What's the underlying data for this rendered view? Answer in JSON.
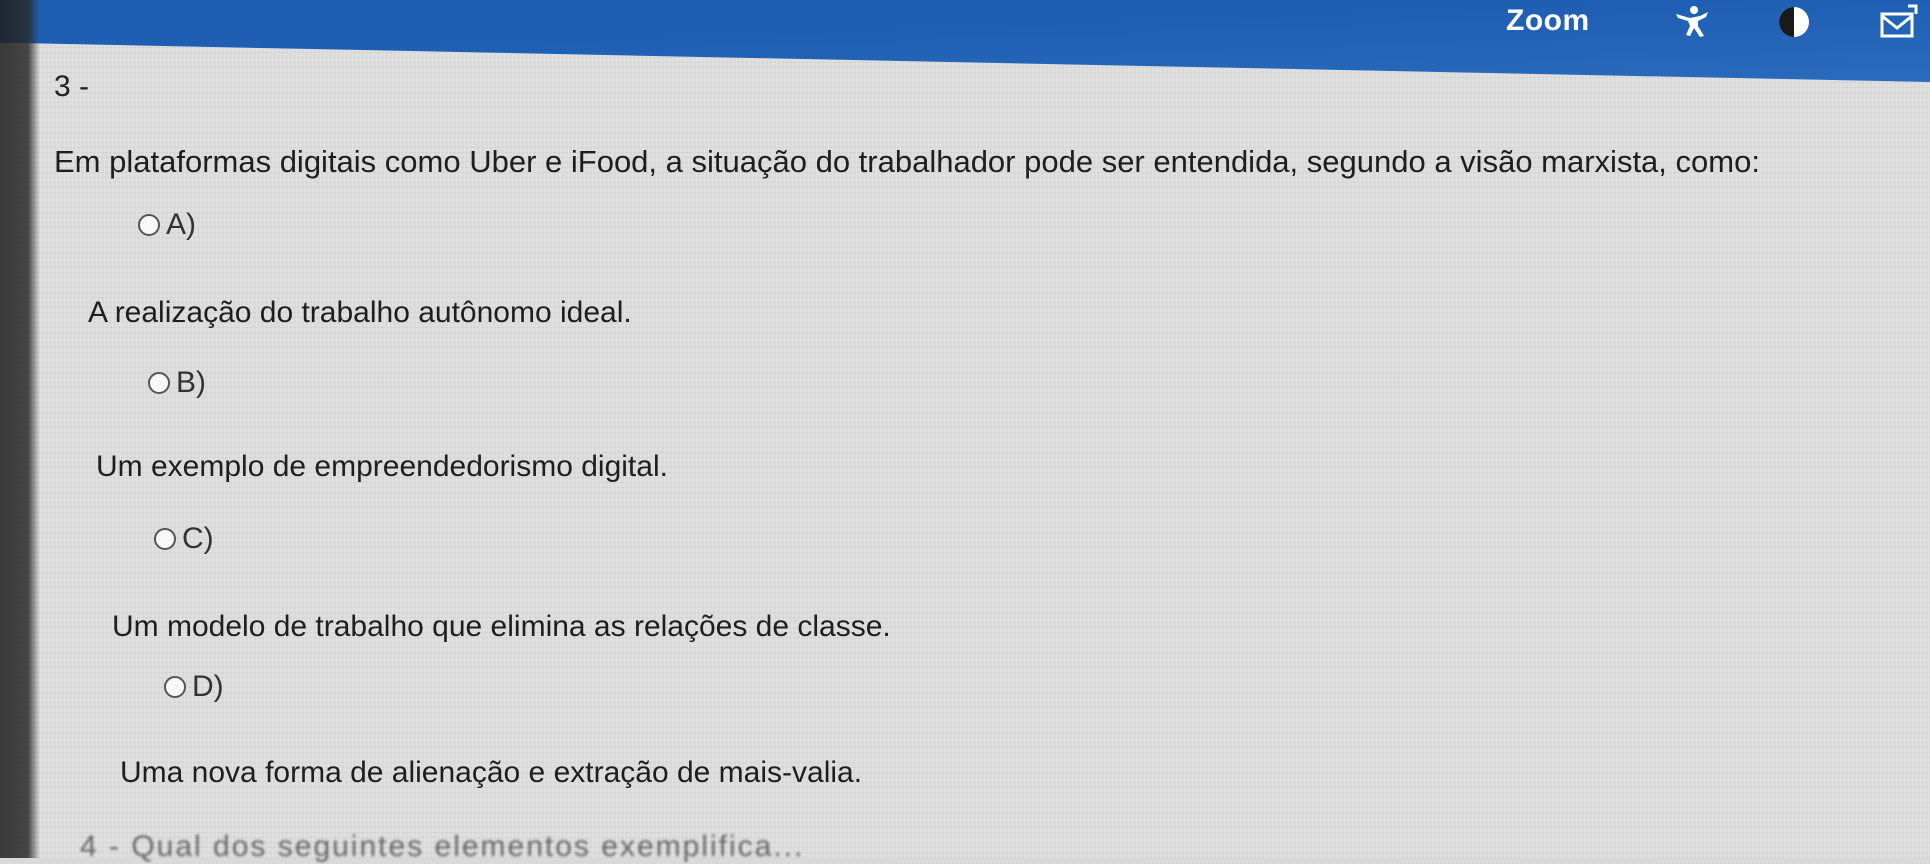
{
  "topbar": {
    "zoom_label": "Zoom",
    "icons": [
      "accessibility-icon",
      "contrast-icon",
      "mail-icon"
    ]
  },
  "question": {
    "number": "3 -",
    "text": "Em plataformas digitais como Uber e iFood, a situação do trabalhador pode ser entendida, segundo a visão marxista, como:",
    "options": [
      {
        "letter": "A)",
        "text": "A realização do trabalho autônomo ideal."
      },
      {
        "letter": "B)",
        "text": "Um exemplo de empreendedorismo digital."
      },
      {
        "letter": "C)",
        "text": "Um modelo de trabalho que elimina as relações de classe."
      },
      {
        "letter": "D)",
        "text": "Uma nova forma de alienação e extração de mais-valia."
      }
    ]
  },
  "next_question": {
    "text": "4 - Qual dos seguintes elementos exemplifica..."
  },
  "colors": {
    "topbar": "#1f5fb3",
    "background": "#dcdcdc",
    "text": "#1e1e1e"
  }
}
